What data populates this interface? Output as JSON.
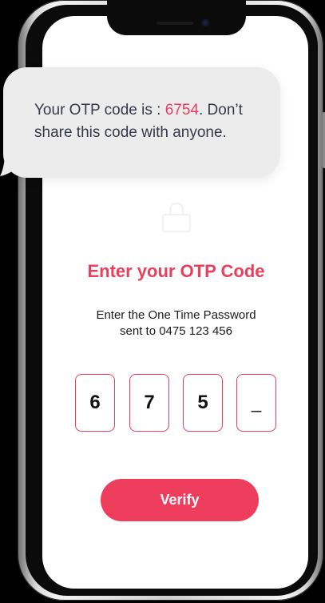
{
  "sms_bubble": {
    "text_before": "Your OTP code is : ",
    "code": "6754",
    "text_after": ". Don’t share this code with anyone."
  },
  "icons": {
    "lock": "lock-icon"
  },
  "otp_screen": {
    "title": "Enter your OTP Code",
    "subtitle_line1": "Enter the One Time Password",
    "subtitle_line2": "sent to 0475 123 456",
    "digits": [
      "6",
      "7",
      "5",
      "_"
    ],
    "verify_label": "Verify"
  },
  "colors": {
    "accent": "#ea3f5b",
    "button": "#ef3d5d",
    "bubble": "#ececec"
  }
}
